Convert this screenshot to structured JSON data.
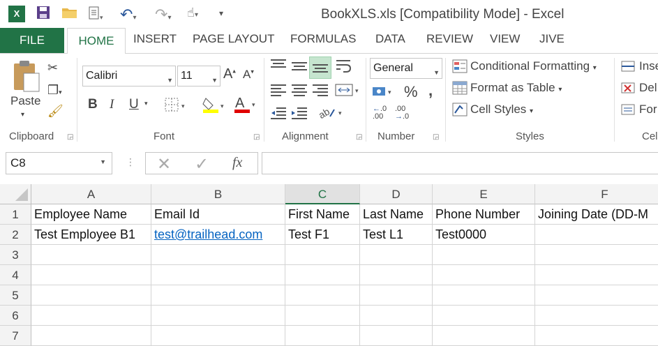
{
  "window": {
    "title": "BookXLS.xls  [Compatibility Mode] - Excel"
  },
  "quick_access": {
    "icons": [
      "excel-logo-icon",
      "save-icon",
      "open-folder-icon",
      "print-preview-icon",
      "undo-icon",
      "redo-icon",
      "touch-mode-icon",
      "customize-icon"
    ]
  },
  "tabs": [
    "FILE",
    "HOME",
    "INSERT",
    "PAGE LAYOUT",
    "FORMULAS",
    "DATA",
    "REVIEW",
    "VIEW",
    "JIVE"
  ],
  "ribbon": {
    "clipboard": {
      "label": "Clipboard",
      "paste": "Paste"
    },
    "font": {
      "label": "Font",
      "font_name": "Calibri",
      "font_size": "11",
      "bold": "B",
      "italic": "I",
      "underline": "U"
    },
    "alignment": {
      "label": "Alignment"
    },
    "number": {
      "label": "Number",
      "format": "General",
      "percent": "%",
      "comma": ","
    },
    "styles": {
      "label": "Styles",
      "conditional": "Conditional Formatting",
      "format_table": "Format as Table",
      "cell_styles": "Cell Styles"
    },
    "cells": {
      "label": "Cel",
      "insert": "Inse",
      "delete": "Del",
      "format": "For"
    }
  },
  "formula_bar": {
    "name_box": "C8",
    "fx": "fx",
    "value": ""
  },
  "columns": [
    "A",
    "B",
    "C",
    "D",
    "E",
    "F"
  ],
  "selected_column": "C",
  "rows": [
    "1",
    "2",
    "3",
    "4",
    "5",
    "6",
    "7"
  ],
  "sheet": [
    [
      "Employee Name",
      "Email Id",
      "First Name",
      "Last Name",
      "Phone Number",
      "Joining Date (DD-M"
    ],
    [
      "Test Employee B1",
      "test@trailhead.com",
      "Test F1",
      "Test L1",
      "Test0000",
      ""
    ],
    [
      "",
      "",
      "",
      "",
      "",
      ""
    ],
    [
      "",
      "",
      "",
      "",
      "",
      ""
    ],
    [
      "",
      "",
      "",
      "",
      "",
      ""
    ],
    [
      "",
      "",
      "",
      "",
      "",
      ""
    ],
    [
      "",
      "",
      "",
      "",
      "",
      ""
    ]
  ],
  "colors": {
    "accent": "#217346",
    "link": "#0563c1"
  }
}
